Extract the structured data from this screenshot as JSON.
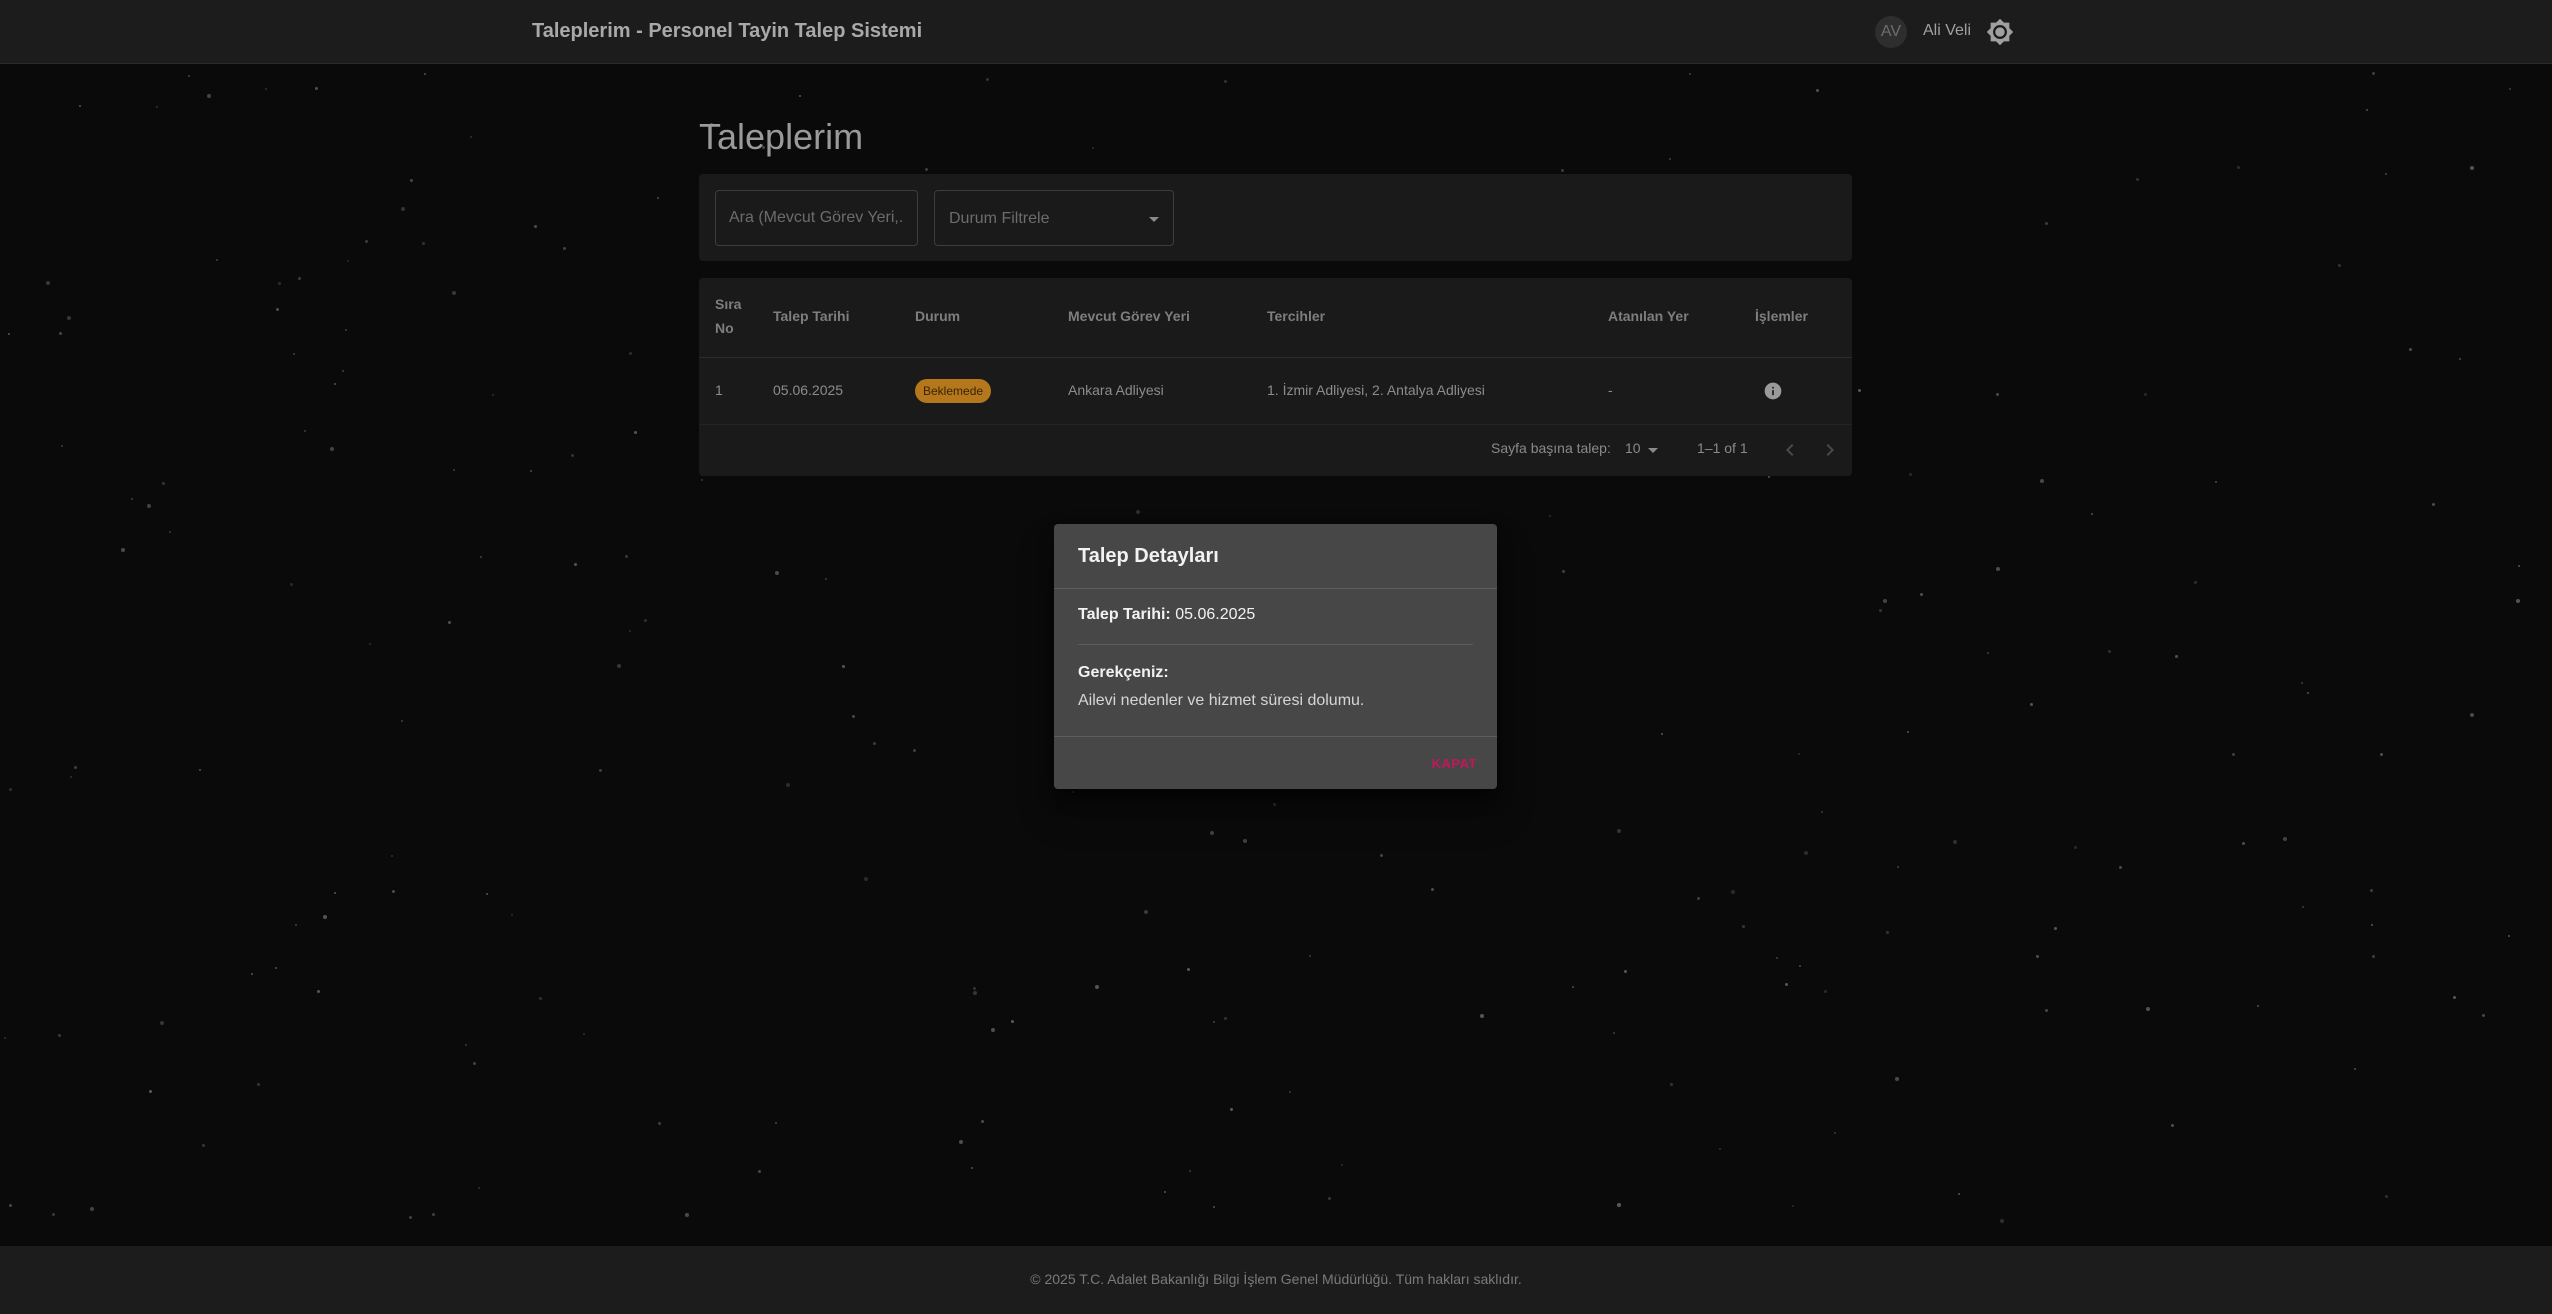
{
  "header": {
    "app_title": "Taleplerim - Personel Tayin Talep Sistemi",
    "avatar_initials": "AV",
    "user_name": "Ali Veli"
  },
  "main": {
    "page_title": "Taleplerim",
    "filters": {
      "search_placeholder": "Ara (Mevcut Görev Yeri,...",
      "status_filter_label": "Durum Filtrele"
    },
    "table": {
      "columns": [
        "Sıra No",
        "Talep Tarihi",
        "Durum",
        "Mevcut Görev Yeri",
        "Tercihler",
        "Atanılan Yer",
        "İşlemler"
      ],
      "rows": [
        {
          "sira_no": "1",
          "talep_tarihi": "05.06.2025",
          "durum": "Beklemede",
          "mevcut_gorev_yeri": "Ankara Adliyesi",
          "tercihler": "1. İzmir Adliyesi, 2. Antalya Adliyesi",
          "atanilan_yer": "-"
        }
      ],
      "pagination": {
        "rows_per_page_label": "Sayfa başına talep:",
        "rows_per_page_value": "10",
        "range_label": "1–1 of 1"
      }
    }
  },
  "dialog": {
    "title": "Talep Detayları",
    "date_label": "Talep Tarihi:",
    "date_value": "05.06.2025",
    "reason_label": "Gerekçeniz:",
    "reason_text": "Ailevi nedenler ve hizmet süresi dolumu.",
    "close_label": "Kapat"
  },
  "footer": {
    "copyright": "© 2025 T.C. Adalet Bakanlığı Bilgi İşlem Genel Müdürlüğü. Tüm hakları saklıdır."
  },
  "colors": {
    "background": "#0a0a0a",
    "header_bg": "#1c1c1c",
    "panel_bg": "#1a1a1a",
    "dialog_bg": "#474747",
    "status_pending": "#b5771b",
    "close_button": "#c2185b"
  },
  "icons": {
    "theme_toggle": "brightness-icon",
    "row_action": "info-icon",
    "prev_page": "chevron-left-icon",
    "next_page": "chevron-right-icon"
  }
}
